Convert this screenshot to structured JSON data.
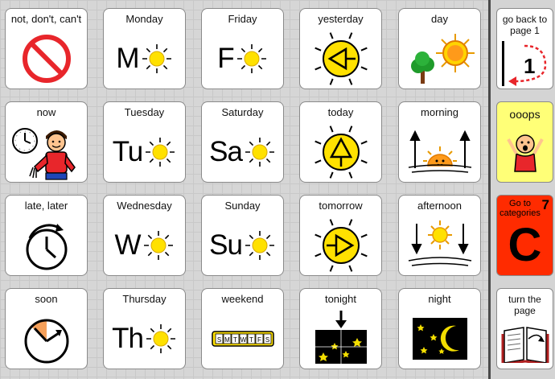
{
  "rows": [
    [
      {
        "label": "not, don't, can't",
        "icon": "prohibited-icon"
      },
      {
        "label": "Monday",
        "abbr": "M",
        "icon": "sun-icon"
      },
      {
        "label": "Friday",
        "abbr": "F",
        "icon": "sun-icon"
      },
      {
        "label": "yesterday",
        "icon": "sun-arrow-left-icon"
      },
      {
        "label": "day",
        "icon": "day-tree-sun-icon"
      }
    ],
    [
      {
        "label": "now",
        "icon": "now-clock-boy-icon"
      },
      {
        "label": "Tuesday",
        "abbr": "Tu",
        "icon": "sun-icon"
      },
      {
        "label": "Saturday",
        "abbr": "Sa",
        "icon": "sun-icon"
      },
      {
        "label": "today",
        "icon": "sun-arrow-up-icon"
      },
      {
        "label": "morning",
        "icon": "sunrise-icon"
      }
    ],
    [
      {
        "label": "late,  later",
        "icon": "clock-arrow-icon"
      },
      {
        "label": "Wednesday",
        "abbr": "W",
        "icon": "sun-icon"
      },
      {
        "label": "Sunday",
        "abbr": "Su",
        "icon": "sun-icon"
      },
      {
        "label": "tomorrow",
        "icon": "sun-arrow-right-icon"
      },
      {
        "label": "afternoon",
        "icon": "afternoon-sun-icon"
      }
    ],
    [
      {
        "label": "soon",
        "icon": "clock-soon-icon"
      },
      {
        "label": "Thursday",
        "abbr": "Th",
        "icon": "sun-icon"
      },
      {
        "label": "weekend",
        "icon": "week-strip-icon",
        "week_letters": [
          "S",
          "M",
          "T",
          "W",
          "T",
          "F",
          "S"
        ]
      },
      {
        "label": "tonight",
        "icon": "night-arrow-icon"
      },
      {
        "label": "night",
        "icon": "moon-stars-icon"
      }
    ]
  ],
  "sidebar": [
    {
      "label": "go back to page 1",
      "badge": "1",
      "icon": "back-arrow-icon",
      "bg": "#ffffff"
    },
    {
      "label": "ooops",
      "icon": "surprised-person-icon",
      "bg": "#ffff77"
    },
    {
      "label": "Go to categories",
      "badge": "7",
      "letter": "C",
      "icon": "letter-c-icon",
      "bg": "#ff2b00"
    },
    {
      "label": "turn the page",
      "icon": "open-book-icon",
      "bg": "#ffffff"
    }
  ],
  "colors": {
    "sun": "#ffe100",
    "sun_orange": "#ff9a1a",
    "prohibit": "#e8262b",
    "night": "#000000",
    "star": "#f2dd00"
  }
}
